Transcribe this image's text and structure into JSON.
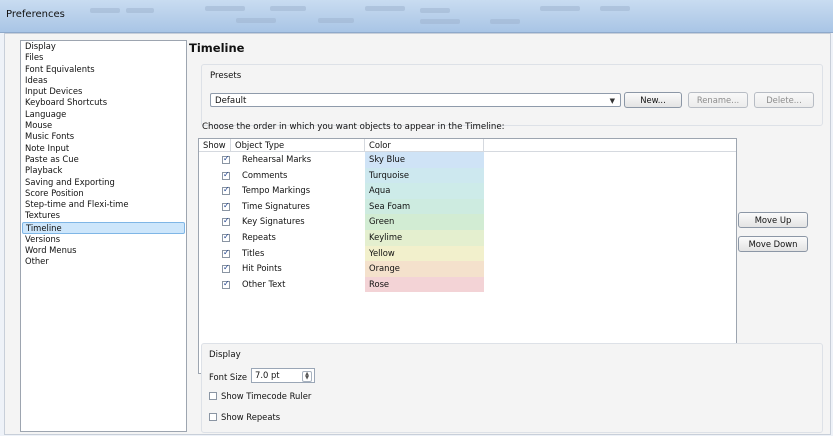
{
  "window": {
    "title": "Preferences"
  },
  "sidebar": {
    "items": [
      "Display",
      "Files",
      "Font Equivalents",
      "Ideas",
      "Input Devices",
      "Keyboard Shortcuts",
      "Language",
      "Mouse",
      "Music Fonts",
      "Note Input",
      "Paste as Cue",
      "Playback",
      "Saving and Exporting",
      "Score Position",
      "Step-time and Flexi-time",
      "Textures",
      "Timeline",
      "Versions",
      "Word Menus",
      "Other"
    ],
    "selected": "Timeline"
  },
  "main": {
    "heading": "Timeline",
    "presets": {
      "label": "Presets",
      "value": "Default",
      "new_label": "New...",
      "rename_label": "Rename...",
      "delete_label": "Delete..."
    },
    "choose_text": "Choose the order in which you want objects to appear in the Timeline:",
    "table": {
      "columns": [
        "Show",
        "Object Type",
        "Color"
      ],
      "rows": [
        {
          "show": true,
          "type": "Rehearsal Marks",
          "color": "Sky Blue",
          "swatch": "#cfe3f6"
        },
        {
          "show": true,
          "type": "Comments",
          "color": "Turquoise",
          "swatch": "#cde8ef"
        },
        {
          "show": true,
          "type": "Tempo Markings",
          "color": "Aqua",
          "swatch": "#cdebe9"
        },
        {
          "show": true,
          "type": "Time Signatures",
          "color": "Sea Foam",
          "swatch": "#cdebe0"
        },
        {
          "show": true,
          "type": "Key Signatures",
          "color": "Green",
          "swatch": "#d2ecd3"
        },
        {
          "show": true,
          "type": "Repeats",
          "color": "Keylime",
          "swatch": "#e4efcf"
        },
        {
          "show": true,
          "type": "Titles",
          "color": "Yellow",
          "swatch": "#f2f0cc"
        },
        {
          "show": true,
          "type": "Hit Points",
          "color": "Orange",
          "swatch": "#f4e1cc"
        },
        {
          "show": true,
          "type": "Other Text",
          "color": "Rose",
          "swatch": "#f3d3d6"
        }
      ]
    },
    "move_up_label": "Move Up",
    "move_down_label": "Move Down",
    "display": {
      "label": "Display",
      "font_size_label": "Font Size",
      "font_size_value": "7.0 pt",
      "show_timecode_label": "Show Timecode Ruler",
      "show_timecode": false,
      "show_repeats_label": "Show Repeats",
      "show_repeats": false
    }
  }
}
